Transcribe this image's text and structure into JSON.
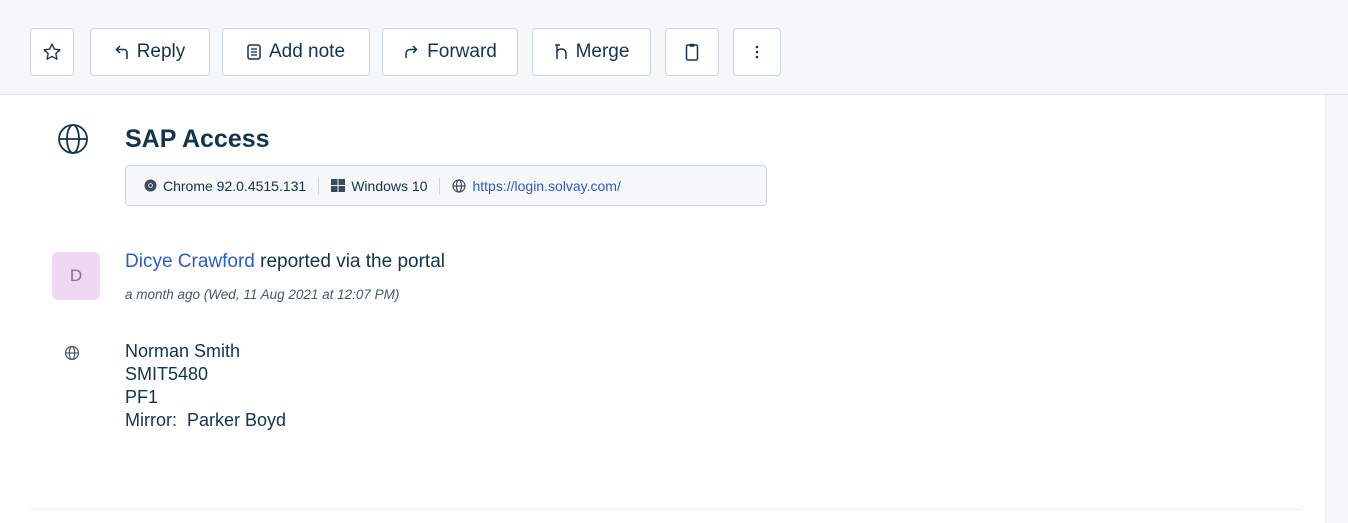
{
  "toolbar": {
    "reply_label": "Reply",
    "add_note_label": "Add note",
    "forward_label": "Forward",
    "merge_label": "Merge"
  },
  "ticket": {
    "title": "SAP Access",
    "browser": "Chrome 92.0.4515.131",
    "os": "Windows 10",
    "url": "https://login.solvay.com/"
  },
  "activity": {
    "avatar_initial": "D",
    "reporter_name": "Dicye Crawford",
    "reported_via": "reported via the portal",
    "timestamp": "a month ago (Wed, 11 Aug 2021 at 12:07 PM)"
  },
  "body": {
    "lines": [
      "Norman Smith",
      "SMIT5480",
      "PF1",
      "Mirror:  Parker Boyd"
    ]
  },
  "colors": {
    "primary_text": "#12344d",
    "link": "#2c5cc5",
    "avatar_bg": "#f0d8f5",
    "toolbar_bg": "#f5f7f9"
  }
}
